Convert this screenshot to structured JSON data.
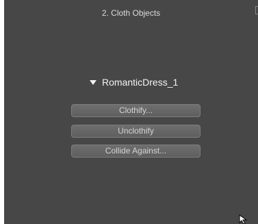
{
  "panel": {
    "title": "2. Cloth Objects"
  },
  "object": {
    "expand_icon": "triangle-down-icon",
    "name": "RomanticDress_1"
  },
  "buttons": {
    "clothify": "Clothify...",
    "unclothify": "Unclothify",
    "collide_against": "Collide Against..."
  },
  "colors": {
    "panel_bg": "#474747",
    "button_bg": "#656565",
    "text": "#f4f4f4"
  }
}
